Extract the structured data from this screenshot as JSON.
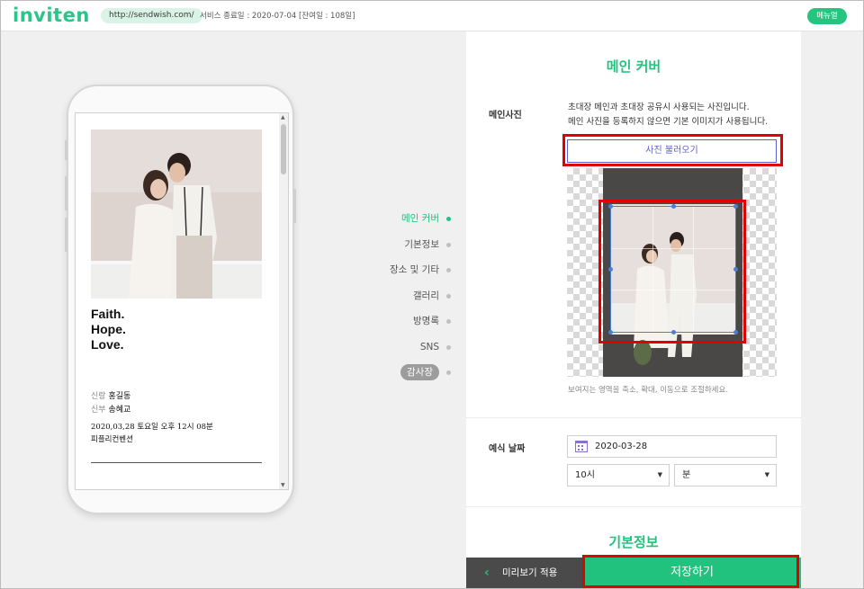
{
  "header": {
    "logo": "inviten",
    "url": "http://sendwish.com/",
    "service_info": "서비스 종료일 : 2020-07-04 [잔여일 : 108일]",
    "menu_label": "메뉴얼"
  },
  "preview": {
    "tagline": [
      "Faith.",
      "Hope.",
      "Love."
    ],
    "groom_role": "신랑",
    "groom_name": "홍길동",
    "bride_role": "신부",
    "bride_name": "송혜교",
    "datetime": "2020,03,28 토요일 오후 12시 08분",
    "venue": "피플리컨벤션"
  },
  "section_nav": [
    {
      "label": "메인 커버",
      "active": true
    },
    {
      "label": "기본정보",
      "active": false
    },
    {
      "label": "장소 및 기타",
      "active": false
    },
    {
      "label": "갤러리",
      "active": false
    },
    {
      "label": "방명록",
      "active": false
    },
    {
      "label": "SNS",
      "active": false
    },
    {
      "label": "감사장",
      "active": false
    }
  ],
  "main_cover": {
    "title": "메인 커버",
    "photo_label": "메인사진",
    "desc_line1": "초대장 메인과 초대장 공유시 사용되는 사진입니다.",
    "desc_line2": "메인 사진을 등록하지 않으면 기본 이미지가 사용됩니다.",
    "upload_label": "사진 불러오기",
    "hint": "보여지는 영역을 축소, 확대, 이동으로 조절하세요."
  },
  "wedding_date": {
    "label": "예식 날짜",
    "date_value": "2020-03-28",
    "hour_value": "10시",
    "minute_value": "분"
  },
  "basic_info": {
    "title": "기본정보"
  },
  "bottom_bar": {
    "preview_label": "미리보기 적용",
    "save_label": "저장하기"
  },
  "colors": {
    "accent": "#21c17e",
    "highlight_border": "#e00000",
    "upload_button": "#5b5fcf"
  },
  "icons": [
    "calendar-icon",
    "chevron-left-icon",
    "dropdown-caret-icon",
    "nav-dot-icon"
  ]
}
